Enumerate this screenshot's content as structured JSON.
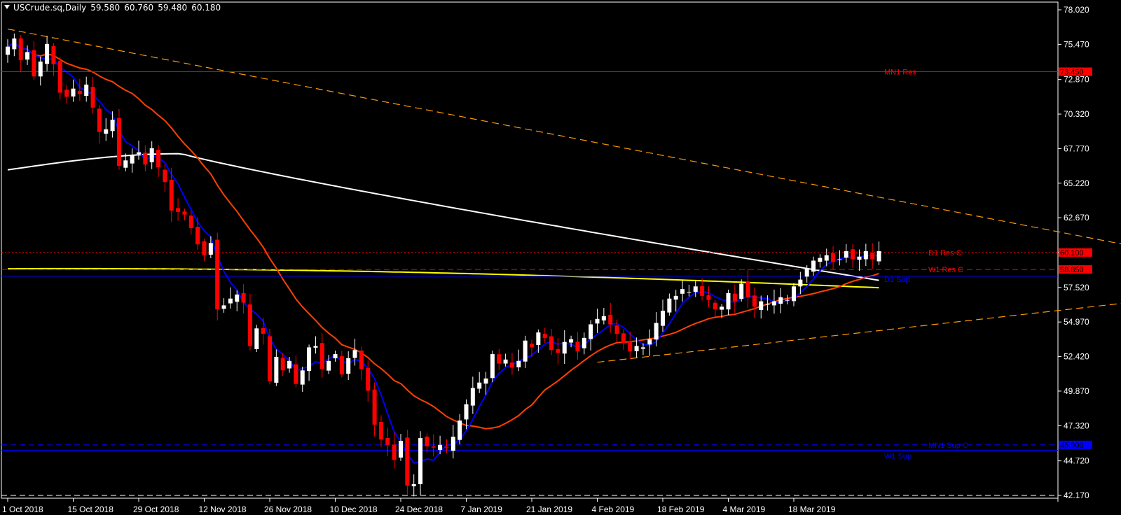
{
  "header": {
    "symbol": "USCrude.sq,Daily",
    "open": "59.580",
    "high": "60.760",
    "low": "59.480",
    "close": "60.180"
  },
  "chart_data": {
    "type": "candlestick",
    "symbol": "USCrude.sq",
    "timeframe": "Daily",
    "ylim": [
      42.17,
      78.02
    ],
    "y_ticks": [
      "78.020",
      "75.470",
      "72.870",
      "70.320",
      "67.770",
      "65.220",
      "62.670",
      "60.100",
      "57.520",
      "54.970",
      "52.420",
      "49.870",
      "47.320",
      "44.720",
      "42.170"
    ],
    "x_ticks": [
      "1 Oct 2018",
      "15 Oct 2018",
      "29 Oct 2018",
      "12 Nov 2018",
      "26 Nov 2018",
      "10 Dec 2018",
      "24 Dec 2018",
      "7 Jan 2019",
      "21 Jan 2019",
      "4 Feb 2019",
      "18 Feb 2019",
      "4 Mar 2019",
      "18 Mar 2019"
    ],
    "x_tick_bars": [
      0,
      10,
      20,
      30,
      40,
      50,
      60,
      70,
      80,
      90,
      100,
      110,
      120
    ],
    "series_closes": [
      75.3,
      75.9,
      74.3,
      74.9,
      73.1,
      74.2,
      75.5,
      74.0,
      71.9,
      71.6,
      72.2,
      71.8,
      72.5,
      70.8,
      69.0,
      69.2,
      69.9,
      66.5,
      66.9,
      67.3,
      67.5,
      66.6,
      67.8,
      66.4,
      65.3,
      63.2,
      63.1,
      62.9,
      61.9,
      60.7,
      59.9,
      60.8,
      55.9,
      56.2,
      56.7,
      57.0,
      56.4,
      53.2,
      54.5,
      54.1,
      50.6,
      52.4,
      51.4,
      52.1,
      50.4,
      51.4,
      53.1,
      53.2,
      51.5,
      52.1,
      52.6,
      51.1,
      52.3,
      52.9,
      51.5,
      49.9,
      47.4,
      46.3,
      45.9,
      44.8,
      46.2,
      42.9,
      43.0,
      46.4,
      45.8,
      45.7,
      45.9,
      45.7,
      46.5,
      47.7,
      48.9,
      50.1,
      50.5,
      50.8,
      52.6,
      51.9,
      52.2,
      51.6,
      52.1,
      53.6,
      53.1,
      54.2,
      53.8,
      52.9,
      52.7,
      53.5,
      53.7,
      52.8,
      53.8,
      54.8,
      55.2,
      55.4,
      54.8,
      54.1,
      53.4,
      52.8,
      53.2,
      53.1,
      53.7,
      54.9,
      55.8,
      56.7,
      56.9,
      57.4,
      57.2,
      57.6,
      56.9,
      56.6,
      55.9,
      56.1,
      57.1,
      56.5,
      57.8,
      56.8,
      56.1,
      56.5,
      56.3,
      56.5,
      56.8,
      56.6,
      57.6,
      58.1,
      58.9,
      59.5,
      59.7,
      59.9,
      59.4,
      59.6,
      60.2,
      59.6,
      59.8,
      60.2,
      59.6,
      60.2
    ],
    "moving_averages": [
      {
        "color": "#0000ff",
        "period_hint": "fast"
      },
      {
        "color": "#ff4000",
        "period_hint": "mid"
      },
      {
        "color": "#ffffff",
        "period_hint": "slow"
      },
      {
        "color": "#ffff00",
        "period_hint": "slowest"
      }
    ],
    "levels": [
      {
        "label": "MN1 Res",
        "value": 73.45,
        "value_label": "73.450",
        "color": "#ff0000",
        "style": "solid"
      },
      {
        "label": "D1 Res C",
        "value": 60.1,
        "value_label": "60.100",
        "color": "#ff0000",
        "style": "dotted"
      },
      {
        "label": "W1 Res C",
        "value": 58.85,
        "value_label": "58.850",
        "color": "#ff0000",
        "style": "dashed"
      },
      {
        "label": "D1 Sup",
        "value": 58.35,
        "value_label": "",
        "color": "#0000ff",
        "style": "solid"
      },
      {
        "label": "MN1 Sup C",
        "value": 45.9,
        "value_label": "45.900",
        "color": "#0000ff",
        "style": "dashed"
      },
      {
        "label": "W1 Sup",
        "value": 45.5,
        "value_label": "",
        "color": "#0000ff",
        "style": "solid"
      },
      {
        "label": "",
        "value": 42.17,
        "value_label": "",
        "color": "#ffffff",
        "style": "dashed"
      }
    ],
    "trendlines": [
      {
        "color": "#ff9900",
        "from": {
          "bar": 0,
          "value": 76.6
        },
        "to": {
          "bar": 300,
          "value": 48.6
        }
      },
      {
        "color": "#ff9900",
        "from": {
          "bar": 90,
          "value": 52.0
        },
        "to": {
          "bar": 300,
          "value": 63.4
        }
      }
    ],
    "grid": false,
    "background": "#000000",
    "bull_color": "#ffffff",
    "bear_color": "#ff0000"
  }
}
